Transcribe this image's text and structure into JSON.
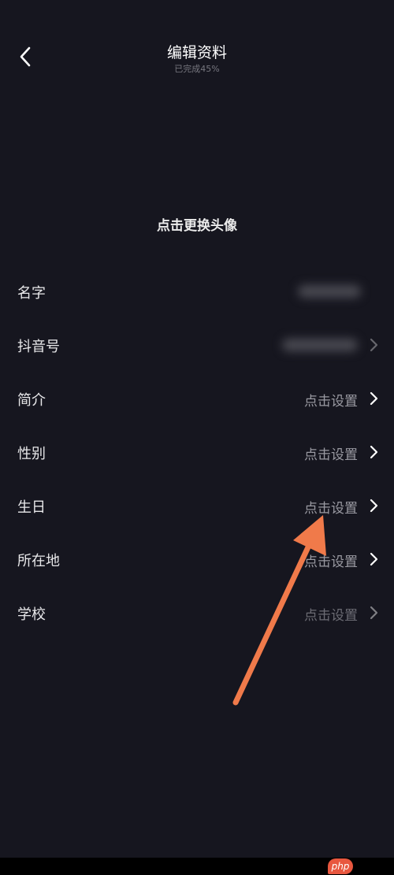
{
  "header": {
    "title": "编辑资料",
    "subtitle": "已完成45%"
  },
  "avatar": {
    "label": "点击更换头像"
  },
  "rows": [
    {
      "label": "名字",
      "value": ""
    },
    {
      "label": "抖音号",
      "value": ""
    },
    {
      "label": "简介",
      "value": "点击设置"
    },
    {
      "label": "性别",
      "value": "点击设置"
    },
    {
      "label": "生日",
      "value": "点击设置"
    },
    {
      "label": "所在地",
      "value": "点击设置"
    },
    {
      "label": "学校",
      "value": "点击设置"
    }
  ],
  "watermark": {
    "text": "php"
  },
  "colors": {
    "background": "#16161f",
    "annotation_arrow": "#f07a4a"
  },
  "icons": {
    "back": "chevron-left-icon",
    "row_arrow": "chevron-right-icon"
  }
}
